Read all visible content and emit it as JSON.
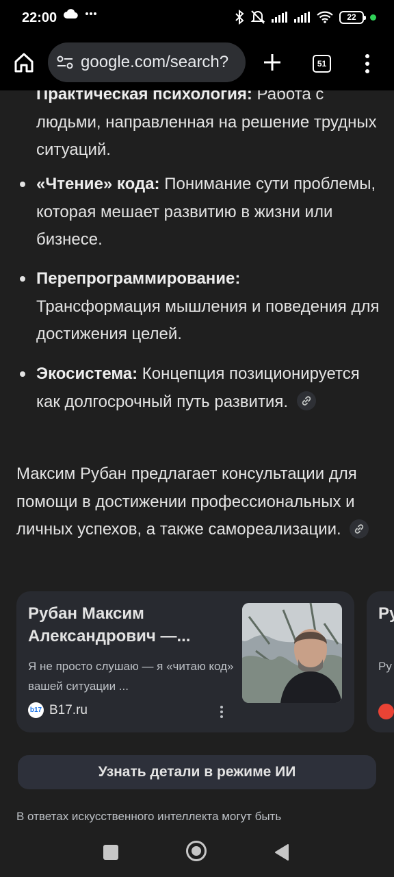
{
  "status_bar": {
    "time": "22:00",
    "battery": "22",
    "icons": [
      "cloud-icon",
      "more-dots-icon",
      "bluetooth-icon",
      "mute-icon",
      "signal-icon",
      "signal-icon",
      "wifi-icon",
      "battery-icon"
    ]
  },
  "toolbar": {
    "url": "google.com/search?",
    "tab_count": "51"
  },
  "content": {
    "partial_line": {
      "bold": "Практическая психология:",
      "text": " Работа с"
    },
    "partial_continuation": "людьми, направленная на решение трудных ситуаций.",
    "bullets": [
      {
        "bold": "«Чтение» кода:",
        "text": " Понимание сути проблемы, которая мешает развитию в жизни или бизнесе."
      },
      {
        "bold": "Перепрограммирование:",
        "text": " Трансформация мышления и поведения для достижения целей."
      },
      {
        "bold": "Экосистема:",
        "text": " Концепция позиционируется как долгосрочный путь развития."
      }
    ],
    "paragraph": "Максим Рубан предлагает консультации для помощи в достижении профессиональных и личных успехов, а также самореализации."
  },
  "cards": [
    {
      "title": "Рубан Максим Александрович —...",
      "snippet": "Я не просто слушаю — я «читаю код» вашей ситуации ...",
      "source": "B17.ru",
      "favicon_text": "b17"
    },
    {
      "title": "Ру Пр",
      "snippet": "Ру пс"
    }
  ],
  "ai_button": "Узнать детали в режиме ИИ",
  "disclaimer": "В ответах искусственного интеллекта могут быть"
}
